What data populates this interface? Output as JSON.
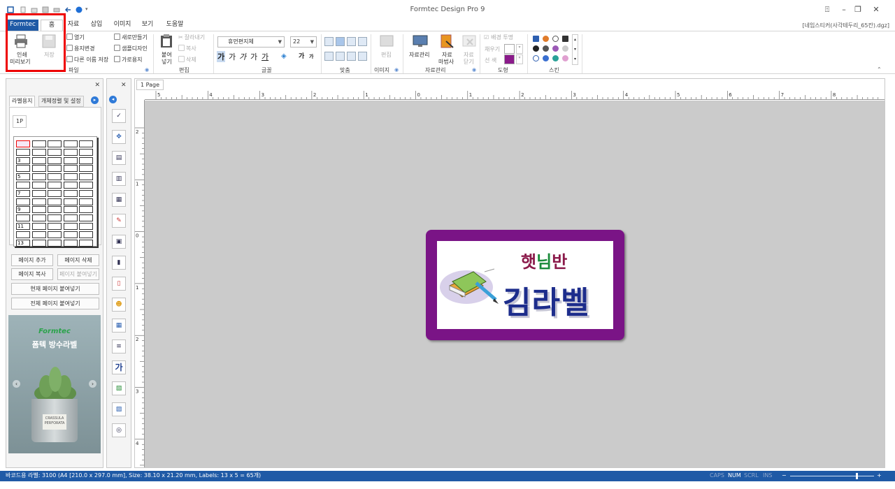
{
  "titlebar": {
    "title": "Formtec Design Pro 9"
  },
  "document": {
    "filename": "[네임스티커(사각테두리_65칸).dgz]"
  },
  "tabs": [
    {
      "label": "Formtec"
    },
    {
      "label": "홈"
    },
    {
      "label": "자료"
    },
    {
      "label": "삽입"
    },
    {
      "label": "이미지"
    },
    {
      "label": "보기"
    },
    {
      "label": "도움말"
    }
  ],
  "ribbon": {
    "file": {
      "group_label": "파일",
      "print_preview_line1": "인쇄",
      "print_preview_line2": "미리보기",
      "save": "저장",
      "open": "열기",
      "change_paper": "용지변경",
      "save_as": "다른 이름 저장",
      "new": "새로만들기",
      "sample_design": "샘플디자인",
      "landscape": "가로용지"
    },
    "edit": {
      "group_label": "편집",
      "paste_line1": "붙여",
      "paste_line2": "넣기",
      "cut": "잘라내기",
      "copy": "복사",
      "delete": "삭제"
    },
    "font": {
      "group_label": "글꼴",
      "font_name": "휴먼편지체",
      "font_size": "22",
      "fmt_buttons": [
        "가",
        "가",
        "가",
        "가",
        "가",
        "가",
        "가"
      ]
    },
    "align": {
      "group_label": "맞춤"
    },
    "image": {
      "group_label": "이미지",
      "edit": "편집"
    },
    "data": {
      "group_label": "자료관리",
      "manage": "자료관리",
      "wizard_line1": "자료",
      "wizard_line2": "마법사",
      "close_line1": "자료",
      "close_line2": "닫기"
    },
    "shape": {
      "group_label": "도형",
      "bg_transparent": "배경 투명",
      "fill": "채우기",
      "line": "선  색",
      "fill_color": "#ffffff",
      "line_color": "#8b1a8b"
    },
    "skin": {
      "group_label": "스킨"
    }
  },
  "left_panel": {
    "tab_label_paper": "라벨용지",
    "tab_object_settings": "개체정렬 및 설정",
    "page_tab": "1P",
    "row_numbers": [
      "1",
      "3",
      "5",
      "7",
      "9",
      "11",
      "13"
    ],
    "add_page": "페이지 추가",
    "delete_page": "페이지 삭제",
    "copy_page": "페이지 복사",
    "paste_page": "페이지 붙여넣기",
    "paste_current": "현재 페이지 붙여넣기",
    "paste_all": "전체 페이지 붙여넣기",
    "ad_brand": "Formtec",
    "ad_title": "폼텍 방수라벨",
    "ad_pot_line1": "CRASSULA",
    "ad_pot_line2": "PERFORATA"
  },
  "canvas": {
    "page_tab": "1 Page",
    "hruler_labels": [
      "5",
      "4",
      "3",
      "2",
      "1",
      "0",
      "1",
      "2",
      "3",
      "4",
      "5",
      "6",
      "7",
      "8"
    ],
    "vruler_labels": [
      "2",
      "1",
      "0",
      "1",
      "2",
      "3",
      "4"
    ],
    "label": {
      "line1_a": "햇",
      "line1_b": "님",
      "line1_c": "반",
      "line1_colors": [
        "#8b1a4a",
        "#1a8b3a",
        "#8b1a4a"
      ],
      "line2": "김라벨",
      "border_color": "#7a1486"
    }
  },
  "statusbar": {
    "text": "바코드용 라벨: 3100 (A4 [210.0 x 297.0 mm], Size: 38.10 x 21.20 mm,  Labels: 13 x 5 = 65개)",
    "caps": "CAPS",
    "num": "NUM",
    "scrl": "SCRL",
    "ins": "INS",
    "zoom_minus": "−",
    "zoom_plus": "+"
  }
}
